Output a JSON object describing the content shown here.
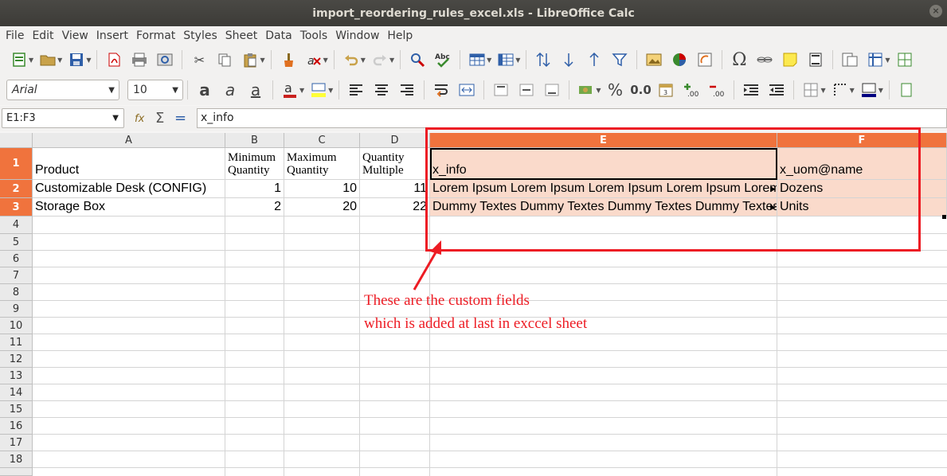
{
  "window": {
    "title": "import_reordering_rules_excel.xls - LibreOffice Calc",
    "close_glyph": "×"
  },
  "menu": [
    "File",
    "Edit",
    "View",
    "Insert",
    "Format",
    "Styles",
    "Sheet",
    "Data",
    "Tools",
    "Window",
    "Help"
  ],
  "format_toolbar": {
    "font_name": "Arial",
    "font_size": "10",
    "percent_label": "%",
    "decimal_label": "0.0"
  },
  "formula_bar": {
    "cell_reference": "E1:F3",
    "content": "x_info"
  },
  "columns": [
    "A",
    "B",
    "C",
    "D",
    "E",
    "F"
  ],
  "rows": [
    "1",
    "2",
    "3",
    "4",
    "5",
    "6",
    "7",
    "8",
    "9",
    "10",
    "11",
    "12",
    "13",
    "14",
    "15",
    "16",
    "17",
    "18"
  ],
  "sheet": {
    "header": {
      "a": "Product",
      "b": "Minimum Quantity",
      "c": "Maximum Quantity",
      "d": "Quantity Multiple",
      "e": "x_info",
      "f": "x_uom@name"
    },
    "row2": {
      "a": "Customizable Desk (CONFIG)",
      "b": "1",
      "c": "10",
      "d": "11",
      "e": "Lorem Ipsum Lorem Ipsum Lorem Ipsum Lorem Ipsum Lorem Ipsum",
      "f": "Dozens"
    },
    "row3": {
      "a": "Storage Box",
      "b": "2",
      "c": "20",
      "d": "22",
      "e": "Dummy Textes Dummy Textes Dummy Textes Dummy Textes",
      "f": "Units"
    }
  },
  "annotation": {
    "line1": "These are the custom fields",
    "line2": "which is added at last in exccel sheet",
    "color": "#ed1c24"
  },
  "selection_color": "#f0733d"
}
